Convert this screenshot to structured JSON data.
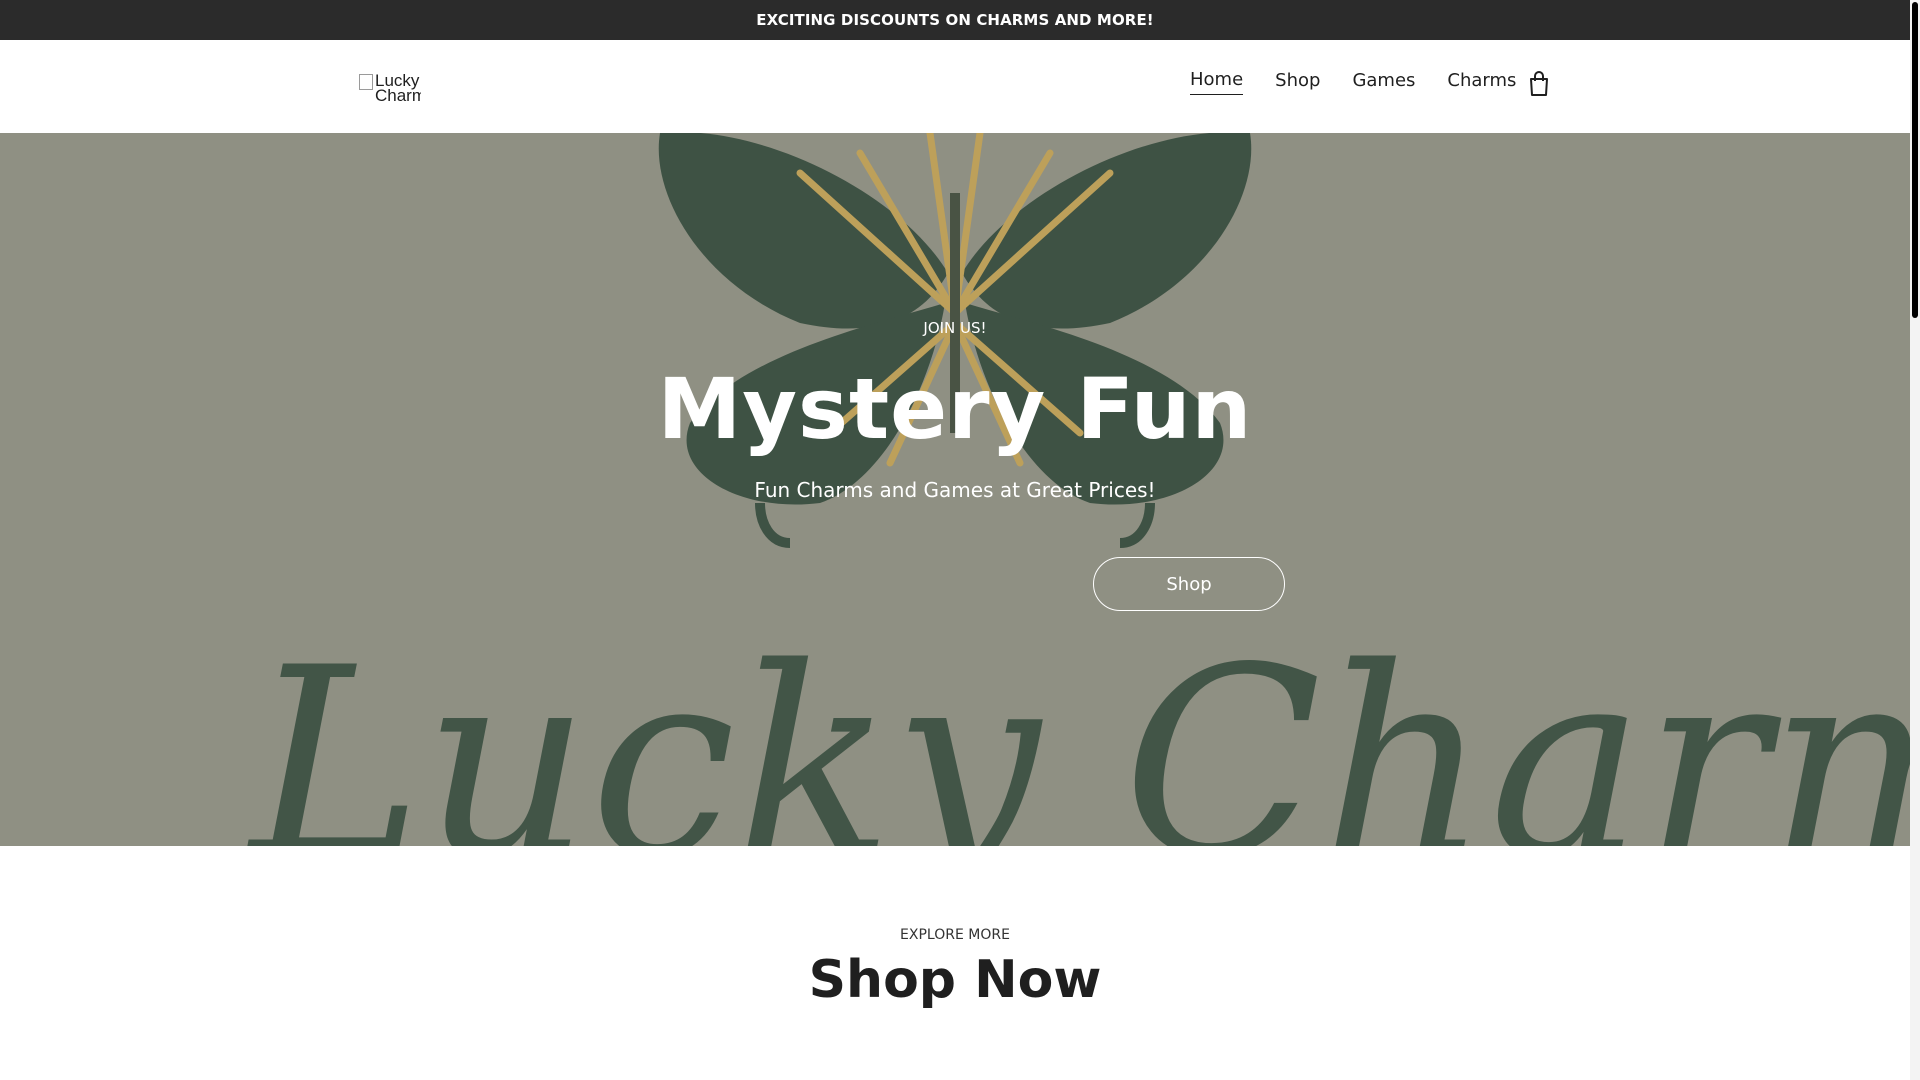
{
  "announcement": {
    "text": "EXCITING DISCOUNTS ON CHARMS AND MORE!"
  },
  "header": {
    "logo_alt": "Lucky Charm",
    "nav": [
      {
        "label": "Home",
        "active": true
      },
      {
        "label": "Shop",
        "active": false
      },
      {
        "label": "Games",
        "active": false
      },
      {
        "label": "Charms",
        "active": false
      }
    ],
    "cart_icon": "shopping-bag-icon"
  },
  "hero": {
    "kicker": "JOIN US!",
    "title": "Mystery Fun",
    "subtitle": "Fun Charms and Games at Great Prices!",
    "button_label": "Shop",
    "background_text": "Lucky Charm",
    "colors": {
      "overlay": "#8a8b80",
      "butterfly": "#1f3a2c",
      "accent": "#c9a24a"
    }
  },
  "explore": {
    "kicker": "EXPLORE MORE",
    "title": "Shop Now"
  }
}
